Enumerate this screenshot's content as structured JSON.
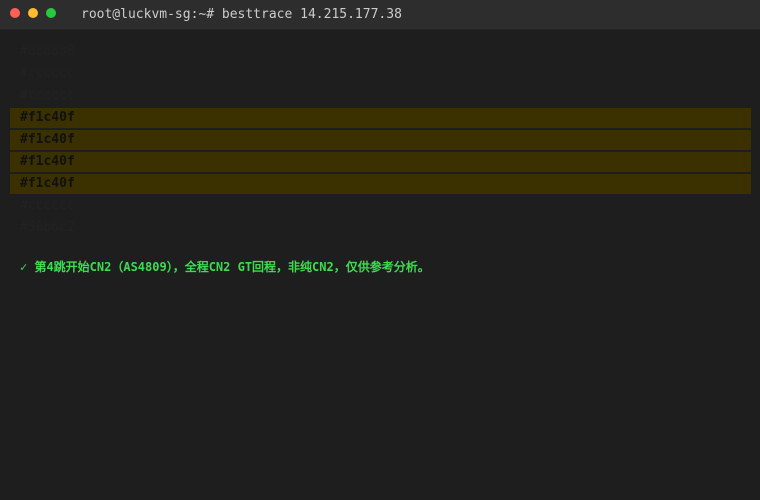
{
  "window": {
    "title": "root@luckvm-sg:~# besttrace 14.215.177.38"
  },
  "lines": [
    {
      "text": "#888888"
    },
    {
      "text": "#cccccc"
    },
    {
      "text": "#cccccc"
    },
    {
      "text": "#f1c40f"
    },
    {
      "text": "#f1c40f"
    },
    {
      "text": "#f1c40f"
    },
    {
      "text": "#f1c40f"
    },
    {
      "text": "#cccccc"
    },
    {
      "text": "#56b6c2"
    }
  ],
  "note": {
    "text": "✓ 第4跳开始CN2（AS4809），全程CN2 GT回程，非纯CN2，仅供参考分析。"
  },
  "colors": {
    "highlight_bg": "#3a3000",
    "note_color": "#3ddc4f"
  }
}
